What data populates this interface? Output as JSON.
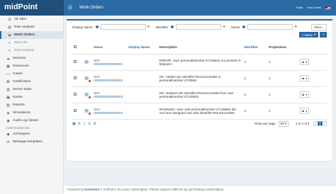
{
  "app": {
    "logo": "midPoint",
    "page_title": "Work Orders"
  },
  "topbar": {
    "roles": "Roles",
    "user": "Work Orders"
  },
  "sidebar": {
    "items": [
      {
        "label": "All roles",
        "icon": "list-icon",
        "sub": true
      },
      {
        "label": "Role analysis",
        "icon": "chart-icon",
        "sub": true
      },
      {
        "label": "Work Orders",
        "icon": "briefcase-icon",
        "sub": true,
        "active": true
      },
      {
        "label": "New role",
        "icon": "plus-icon",
        "sub": true,
        "muted": true
      },
      {
        "label": "New analysis",
        "icon": "plus-icon",
        "sub": true,
        "muted": true
      },
      {
        "label": "Services",
        "icon": "cloud-icon",
        "chev": true
      },
      {
        "label": "Resources",
        "icon": "database-icon",
        "chev": true
      },
      {
        "label": "Cases",
        "icon": "folder-icon",
        "chev": true
      },
      {
        "label": "Certification",
        "icon": "certificate-icon",
        "chev": true
      },
      {
        "label": "Server tasks",
        "icon": "task-icon",
        "chev": true
      },
      {
        "label": "Nodes",
        "icon": "server-icon",
        "chev": true
      },
      {
        "label": "Reports",
        "icon": "report-icon",
        "chev": true
      },
      {
        "label": "Simulations",
        "icon": "simulation-icon",
        "chev": true
      },
      {
        "label": "Audit Log Viewer",
        "icon": "audit-icon"
      }
    ],
    "section": "CONFIGURATION",
    "config_items": [
      {
        "label": "Archetypes",
        "icon": "archetype-icon",
        "chev": true
      },
      {
        "label": "Message templates",
        "icon": "message-icon",
        "chev": true
      }
    ]
  },
  "filters": {
    "display_name": "Display Name",
    "identifier": "Identifier",
    "name": "Name",
    "more": "More..."
  },
  "actions": {
    "basic": "Basic"
  },
  "table": {
    "headers": [
      "Name",
      "Display Name",
      "Description",
      "Identifier",
      "Projections"
    ],
    "rows": [
      {
        "name": "WO-0000000000000001",
        "description": "ERROR: User personalNumber:47128562 not present in Midpoint",
        "identifier": "1",
        "projections": "1",
        "badge": ""
      },
      {
        "name": "WO-0000000000000002",
        "description": "OK: Added role identifier:ROLE2144255 to personalNumber:4728562",
        "identifier": "2",
        "projections": "1",
        "badge": "#c0392b"
      },
      {
        "name": "WO-0000000000000003",
        "description": "OK: Deleted role identifier:ROLE2144255 from user personalNumber:47128562",
        "identifier": "3",
        "projections": "1",
        "badge": "#c0392b"
      },
      {
        "name": "WO-0000000000000004",
        "description": "WARNING: User with personalNumber:47128562 did not have assigned role with identifier:ROLE2144255",
        "identifier": "4",
        "projections": "1",
        "badge": "#c0392b"
      }
    ]
  },
  "footer": {
    "rows_per_page_label": "Rows per page",
    "rows_per_page": "50",
    "range": "1 to 4 of 4",
    "current_page": "1"
  },
  "bottom": {
    "powered": "Powered by",
    "product": "Evolveum",
    "rest": "© midPoint. No active subscription. Please support midPoint by purchasing a subscription."
  }
}
